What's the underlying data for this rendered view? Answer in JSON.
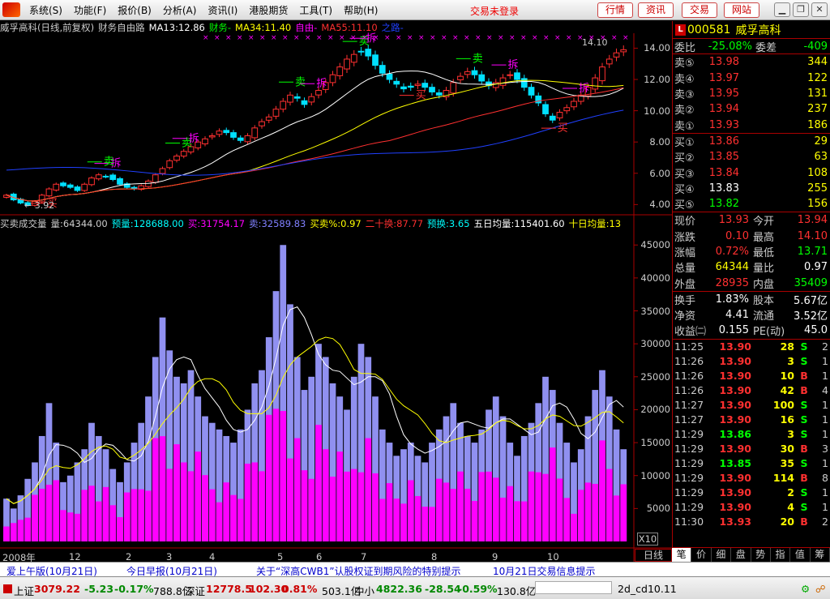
{
  "menu": {
    "items": [
      "系统(S)",
      "功能(F)",
      "报价(B)",
      "分析(A)",
      "资讯(I)",
      "港股期货",
      "工具(T)",
      "帮助(H)"
    ],
    "trade_status": "交易未登录",
    "buttons": [
      "行情",
      "资讯",
      "交易",
      "网站"
    ],
    "window_controls": [
      "minimize-icon",
      "restore-icon",
      "close-icon"
    ]
  },
  "chart": {
    "header": [
      {
        "text": "威孚高科(日线,前复权)",
        "color": "#cccccc"
      },
      {
        "text": "财务自由路",
        "color": "#cccccc"
      },
      {
        "text": "MA13:12.86",
        "color": "#ffffff"
      },
      {
        "text": "财务-",
        "color": "#00ff00"
      },
      {
        "text": "MA34:11.40",
        "color": "#ffff00"
      },
      {
        "text": "自由-",
        "color": "#ff00ff"
      },
      {
        "text": "MA55:11.10",
        "color": "#ff3030"
      },
      {
        "text": "之路-",
        "color": "#2040ff"
      }
    ],
    "price_axis": [
      "14.00",
      "12.00",
      "10.00",
      "8.00",
      "6.00",
      "4.00"
    ],
    "low_label": "3.92",
    "high_label": "14.10",
    "signals": [
      "卖",
      "拆",
      "买"
    ],
    "vol_header": [
      {
        "text": "买卖成交量",
        "color": "#cccccc"
      },
      {
        "text": "量:64344.00",
        "color": "#cccccc"
      },
      {
        "text": "预量:128688.00",
        "color": "#00ffff"
      },
      {
        "text": "买:31754.17",
        "color": "#ff00ff"
      },
      {
        "text": "卖:32589.83",
        "color": "#8080ff"
      },
      {
        "text": "买卖%:0.97",
        "color": "#ffff00"
      },
      {
        "text": "二十换:87.77",
        "color": "#ff3030"
      },
      {
        "text": "预换:3.65",
        "color": "#00ffff"
      },
      {
        "text": "五日均量:115401.60",
        "color": "#ffffff"
      },
      {
        "text": "十日均量:13",
        "color": "#ffff00"
      }
    ],
    "vol_axis": [
      "45000",
      "40000",
      "35000",
      "30000",
      "25000",
      "20000",
      "15000",
      "10000",
      "5000"
    ],
    "vol_multiplier": "X10",
    "x_labels": [
      "2008年",
      "12",
      "2",
      "3",
      "4",
      "5",
      "6",
      "7",
      "8",
      "9",
      "10"
    ],
    "period": "日线"
  },
  "chart_data": {
    "type": "candlestick",
    "close": [
      4.6,
      4.3,
      4.1,
      3.95,
      4.2,
      4.6,
      5.0,
      5.3,
      5.2,
      5.1,
      4.9,
      5.3,
      5.7,
      5.9,
      5.8,
      5.6,
      5.3,
      5.1,
      5.0,
      5.2,
      5.5,
      5.9,
      6.3,
      6.8,
      7.1,
      7.4,
      7.7,
      8.0,
      8.2,
      8.4,
      8.7,
      8.6,
      8.3,
      8.1,
      8.4,
      8.9,
      9.3,
      9.6,
      10.1,
      10.6,
      11.0,
      10.8,
      10.4,
      10.9,
      11.3,
      11.8,
      12.3,
      12.8,
      13.3,
      13.6,
      13.8,
      13.5,
      12.9,
      12.4,
      12.0,
      11.7,
      11.4,
      11.5,
      11.7,
      11.5,
      11.2,
      11.0,
      11.3,
      11.8,
      12.2,
      12.5,
      12.3,
      11.9,
      11.6,
      11.8,
      12.1,
      12.3,
      12.0,
      11.5,
      11.0,
      10.5,
      9.8,
      9.4,
      9.9,
      10.2,
      10.6,
      11.0,
      11.5,
      12.1,
      12.8,
      13.3,
      13.7,
      13.9
    ],
    "volume_x10": [
      6500,
      5000,
      7000,
      9500,
      12000,
      16000,
      21000,
      15000,
      9000,
      10000,
      12000,
      14000,
      18000,
      16000,
      14000,
      11000,
      9000,
      12000,
      15000,
      18000,
      22000,
      28000,
      34000,
      29000,
      25000,
      24000,
      26000,
      22000,
      19000,
      18000,
      17000,
      16000,
      15000,
      17000,
      20000,
      24000,
      26000,
      31000,
      38000,
      45000,
      36000,
      28000,
      23000,
      25000,
      30000,
      28000,
      24000,
      22000,
      20000,
      25000,
      30000,
      28000,
      22000,
      17000,
      15000,
      13000,
      14000,
      15000,
      13000,
      12000,
      15000,
      17000,
      19000,
      21000,
      18000,
      16000,
      15000,
      17000,
      20000,
      22000,
      19000,
      15000,
      13000,
      16000,
      18000,
      21000,
      25000,
      23000,
      18000,
      15000,
      12000,
      14000,
      19000,
      23000,
      26000,
      22000,
      17000,
      14000
    ],
    "ylim": [
      3.5,
      14.8
    ],
    "vol_ylim": [
      0,
      47000
    ]
  },
  "side": {
    "code": "000581",
    "name": "威孚高科",
    "ratio": {
      "label": "委比",
      "value": "-25.08%",
      "label2": "委差",
      "value2": "-409"
    },
    "asks": [
      {
        "label": "卖⑤",
        "price": "13.98",
        "vol": "344"
      },
      {
        "label": "卖④",
        "price": "13.97",
        "vol": "122"
      },
      {
        "label": "卖③",
        "price": "13.95",
        "vol": "131"
      },
      {
        "label": "卖②",
        "price": "13.94",
        "vol": "237"
      },
      {
        "label": "卖①",
        "price": "13.93",
        "vol": "186"
      }
    ],
    "bids": [
      {
        "label": "买①",
        "price": "13.86",
        "vol": "29",
        "color": "#ff3030"
      },
      {
        "label": "买②",
        "price": "13.85",
        "vol": "63",
        "color": "#ff3030"
      },
      {
        "label": "买③",
        "price": "13.84",
        "vol": "108",
        "color": "#ff3030"
      },
      {
        "label": "买④",
        "price": "13.83",
        "vol": "255",
        "color": "#ffffff"
      },
      {
        "label": "买⑤",
        "price": "13.82",
        "vol": "156",
        "color": "#00ff00"
      }
    ],
    "stats": [
      {
        "l1": "现价",
        "v1": "13.93",
        "c1": "#ff3030",
        "l2": "今开",
        "v2": "13.94",
        "c2": "#ff3030"
      },
      {
        "l1": "涨跌",
        "v1": "0.10",
        "c1": "#ff3030",
        "l2": "最高",
        "v2": "14.10",
        "c2": "#ff3030"
      },
      {
        "l1": "涨幅",
        "v1": "0.72%",
        "c1": "#ff3030",
        "l2": "最低",
        "v2": "13.71",
        "c2": "#00ff00"
      },
      {
        "l1": "总量",
        "v1": "64344",
        "c1": "#ffff00",
        "l2": "量比",
        "v2": "0.97",
        "c2": "#ffffff"
      },
      {
        "l1": "外盘",
        "v1": "28935",
        "c1": "#ff3030",
        "l2": "内盘",
        "v2": "35409",
        "c2": "#00ff00"
      }
    ],
    "stats2": [
      {
        "l1": "换手",
        "v1": "1.83%",
        "l2": "股本",
        "v2": "5.67亿"
      },
      {
        "l1": "净资",
        "v1": "4.41",
        "l2": "流通",
        "v2": "3.52亿"
      },
      {
        "l1": "收益㈡",
        "v1": "0.155",
        "l2": "PE(动)",
        "v2": "45.0"
      }
    ],
    "ticks": [
      {
        "t": "11:25",
        "p": "13.90",
        "v": "28",
        "f": "S",
        "n": "2"
      },
      {
        "t": "11:26",
        "p": "13.90",
        "v": "3",
        "f": "S",
        "n": "1"
      },
      {
        "t": "11:26",
        "p": "13.90",
        "v": "10",
        "f": "B",
        "n": "1"
      },
      {
        "t": "11:26",
        "p": "13.90",
        "v": "42",
        "f": "B",
        "n": "4"
      },
      {
        "t": "11:27",
        "p": "13.90",
        "v": "100",
        "f": "S",
        "n": "1"
      },
      {
        "t": "11:27",
        "p": "13.90",
        "v": "16",
        "f": "S",
        "n": "1"
      },
      {
        "t": "11:29",
        "p": "13.86",
        "v": "3",
        "f": "S",
        "n": "1"
      },
      {
        "t": "11:29",
        "p": "13.90",
        "v": "30",
        "f": "B",
        "n": "3"
      },
      {
        "t": "11:29",
        "p": "13.85",
        "v": "35",
        "f": "S",
        "n": "1"
      },
      {
        "t": "11:29",
        "p": "13.90",
        "v": "114",
        "f": "B",
        "n": "8"
      },
      {
        "t": "11:29",
        "p": "13.90",
        "v": "2",
        "f": "S",
        "n": "1"
      },
      {
        "t": "11:29",
        "p": "13.90",
        "v": "4",
        "f": "S",
        "n": "1"
      },
      {
        "t": "11:30",
        "p": "13.93",
        "v": "20",
        "f": "B",
        "n": "2"
      }
    ],
    "tabs": [
      "笔",
      "价",
      "细",
      "盘",
      "势",
      "指",
      "值",
      "筹"
    ]
  },
  "news": [
    "爱上午版(10月21日)",
    "今日早报(10月21日)",
    "关于“深高CWB1”认股权证到期风险的特别提示",
    "10月21日交易信息提示"
  ],
  "status": {
    "sh_label": "上证",
    "sh_val": "3079.22",
    "sh_chg": "-5.23",
    "sh_pct": "-0.17%",
    "sh_amt": "788.8亿",
    "sz_label": "深证",
    "sz_val": "12778.5",
    "sz_chg": "102.30",
    "sz_pct": "0.81%",
    "sz_amt": "503.1亿",
    "zx_label": "中小",
    "zx_val": "4822.36",
    "zx_chg": "-28.54",
    "zx_pct": "-0.59%",
    "zx_amt": "130.8亿",
    "file": "2d_cd10.11"
  }
}
